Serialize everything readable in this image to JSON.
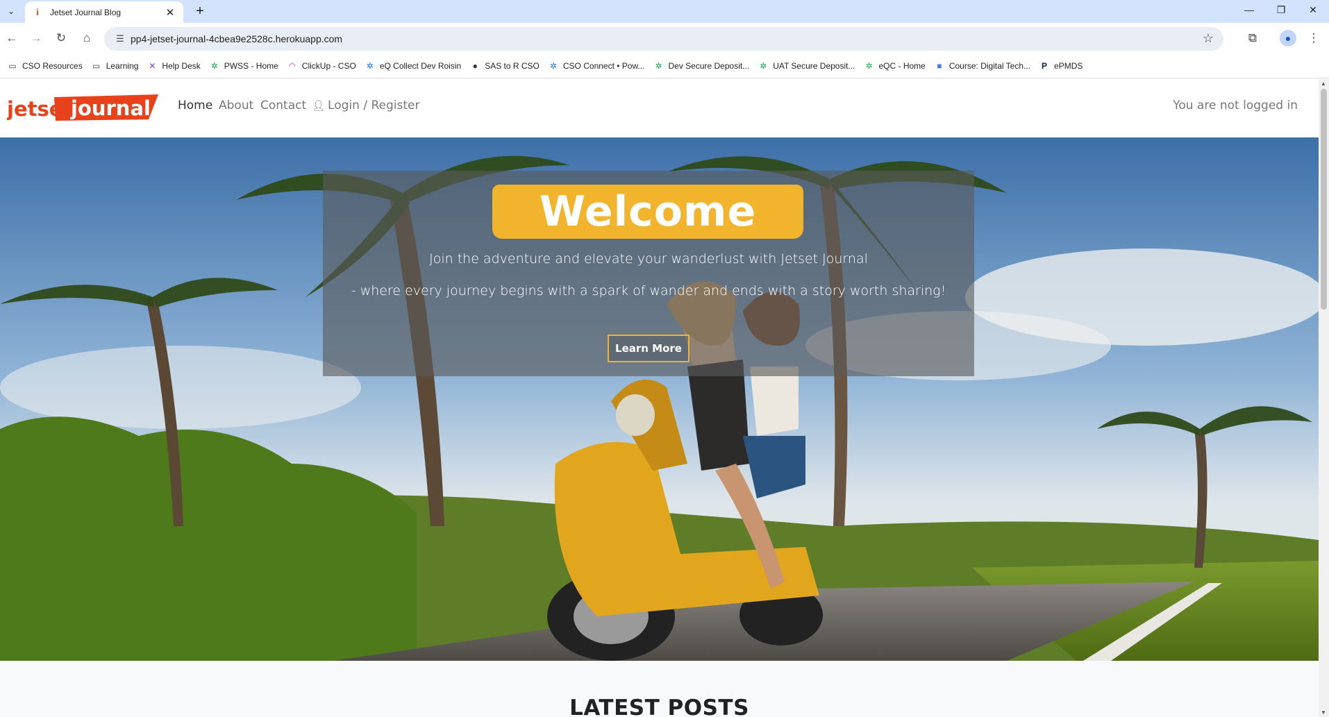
{
  "browser": {
    "tab_title": "Jetset Journal Blog",
    "tab_favicon": "i",
    "url": "pp4-jetset-journal-4cbea9e2528c.herokuapp.com",
    "bookmarks": [
      {
        "label": "CSO Resources",
        "icon": "folder-icon",
        "glyph": "▭",
        "color": "#444444"
      },
      {
        "label": "Learning",
        "icon": "folder-icon",
        "glyph": "▭",
        "color": "#444444"
      },
      {
        "label": "Help Desk",
        "icon": "x-logo-icon",
        "glyph": "✕",
        "color": "#7b3fe4"
      },
      {
        "label": "PWSS - Home",
        "icon": "pinwheel-icon",
        "glyph": "✲",
        "color": "#1aa34a"
      },
      {
        "label": "ClickUp - CSO",
        "icon": "clickup-icon",
        "glyph": "◠",
        "color": "#e8368f"
      },
      {
        "label": "eQ Collect Dev Roisin",
        "icon": "pinwheel-icon",
        "glyph": "✲",
        "color": "#1a73e8"
      },
      {
        "label": "SAS to R CSO",
        "icon": "globe-icon",
        "glyph": "●",
        "color": "#333333"
      },
      {
        "label": "CSO Connect • Pow...",
        "icon": "pinwheel-icon",
        "glyph": "✲",
        "color": "#1a73e8"
      },
      {
        "label": "Dev Secure Deposit...",
        "icon": "pinwheel-icon",
        "glyph": "✲",
        "color": "#1aa34a"
      },
      {
        "label": "UAT Secure Deposit...",
        "icon": "pinwheel-icon",
        "glyph": "✲",
        "color": "#1aa34a"
      },
      {
        "label": "eQC - Home",
        "icon": "pinwheel-icon",
        "glyph": "✲",
        "color": "#1aa34a"
      },
      {
        "label": "Course: Digital Tech...",
        "icon": "lock-icon",
        "glyph": "■",
        "color": "#4a7fd6"
      },
      {
        "label": "ePMDS",
        "icon": "p-logo-icon",
        "glyph": "P",
        "color": "#0b1f4a"
      }
    ]
  },
  "site": {
    "logo_text_1": "jetset",
    "logo_text_2": "journal",
    "nav": {
      "home": "Home",
      "about": "About",
      "contact": "Contact",
      "login": "Login / Register"
    },
    "login_status": "You are not logged in"
  },
  "hero": {
    "welcome": "Welcome",
    "tagline_1": "Join the adventure and elevate your wanderlust with Jetset Journal",
    "tagline_2": "- where every journey begins with a spark of wander and ends with a story worth sharing!",
    "button": "Learn More"
  },
  "latest_heading": "LATEST POSTS",
  "colors": {
    "brand_orange": "#e8421d",
    "accent_yellow": "#f2b32d"
  }
}
